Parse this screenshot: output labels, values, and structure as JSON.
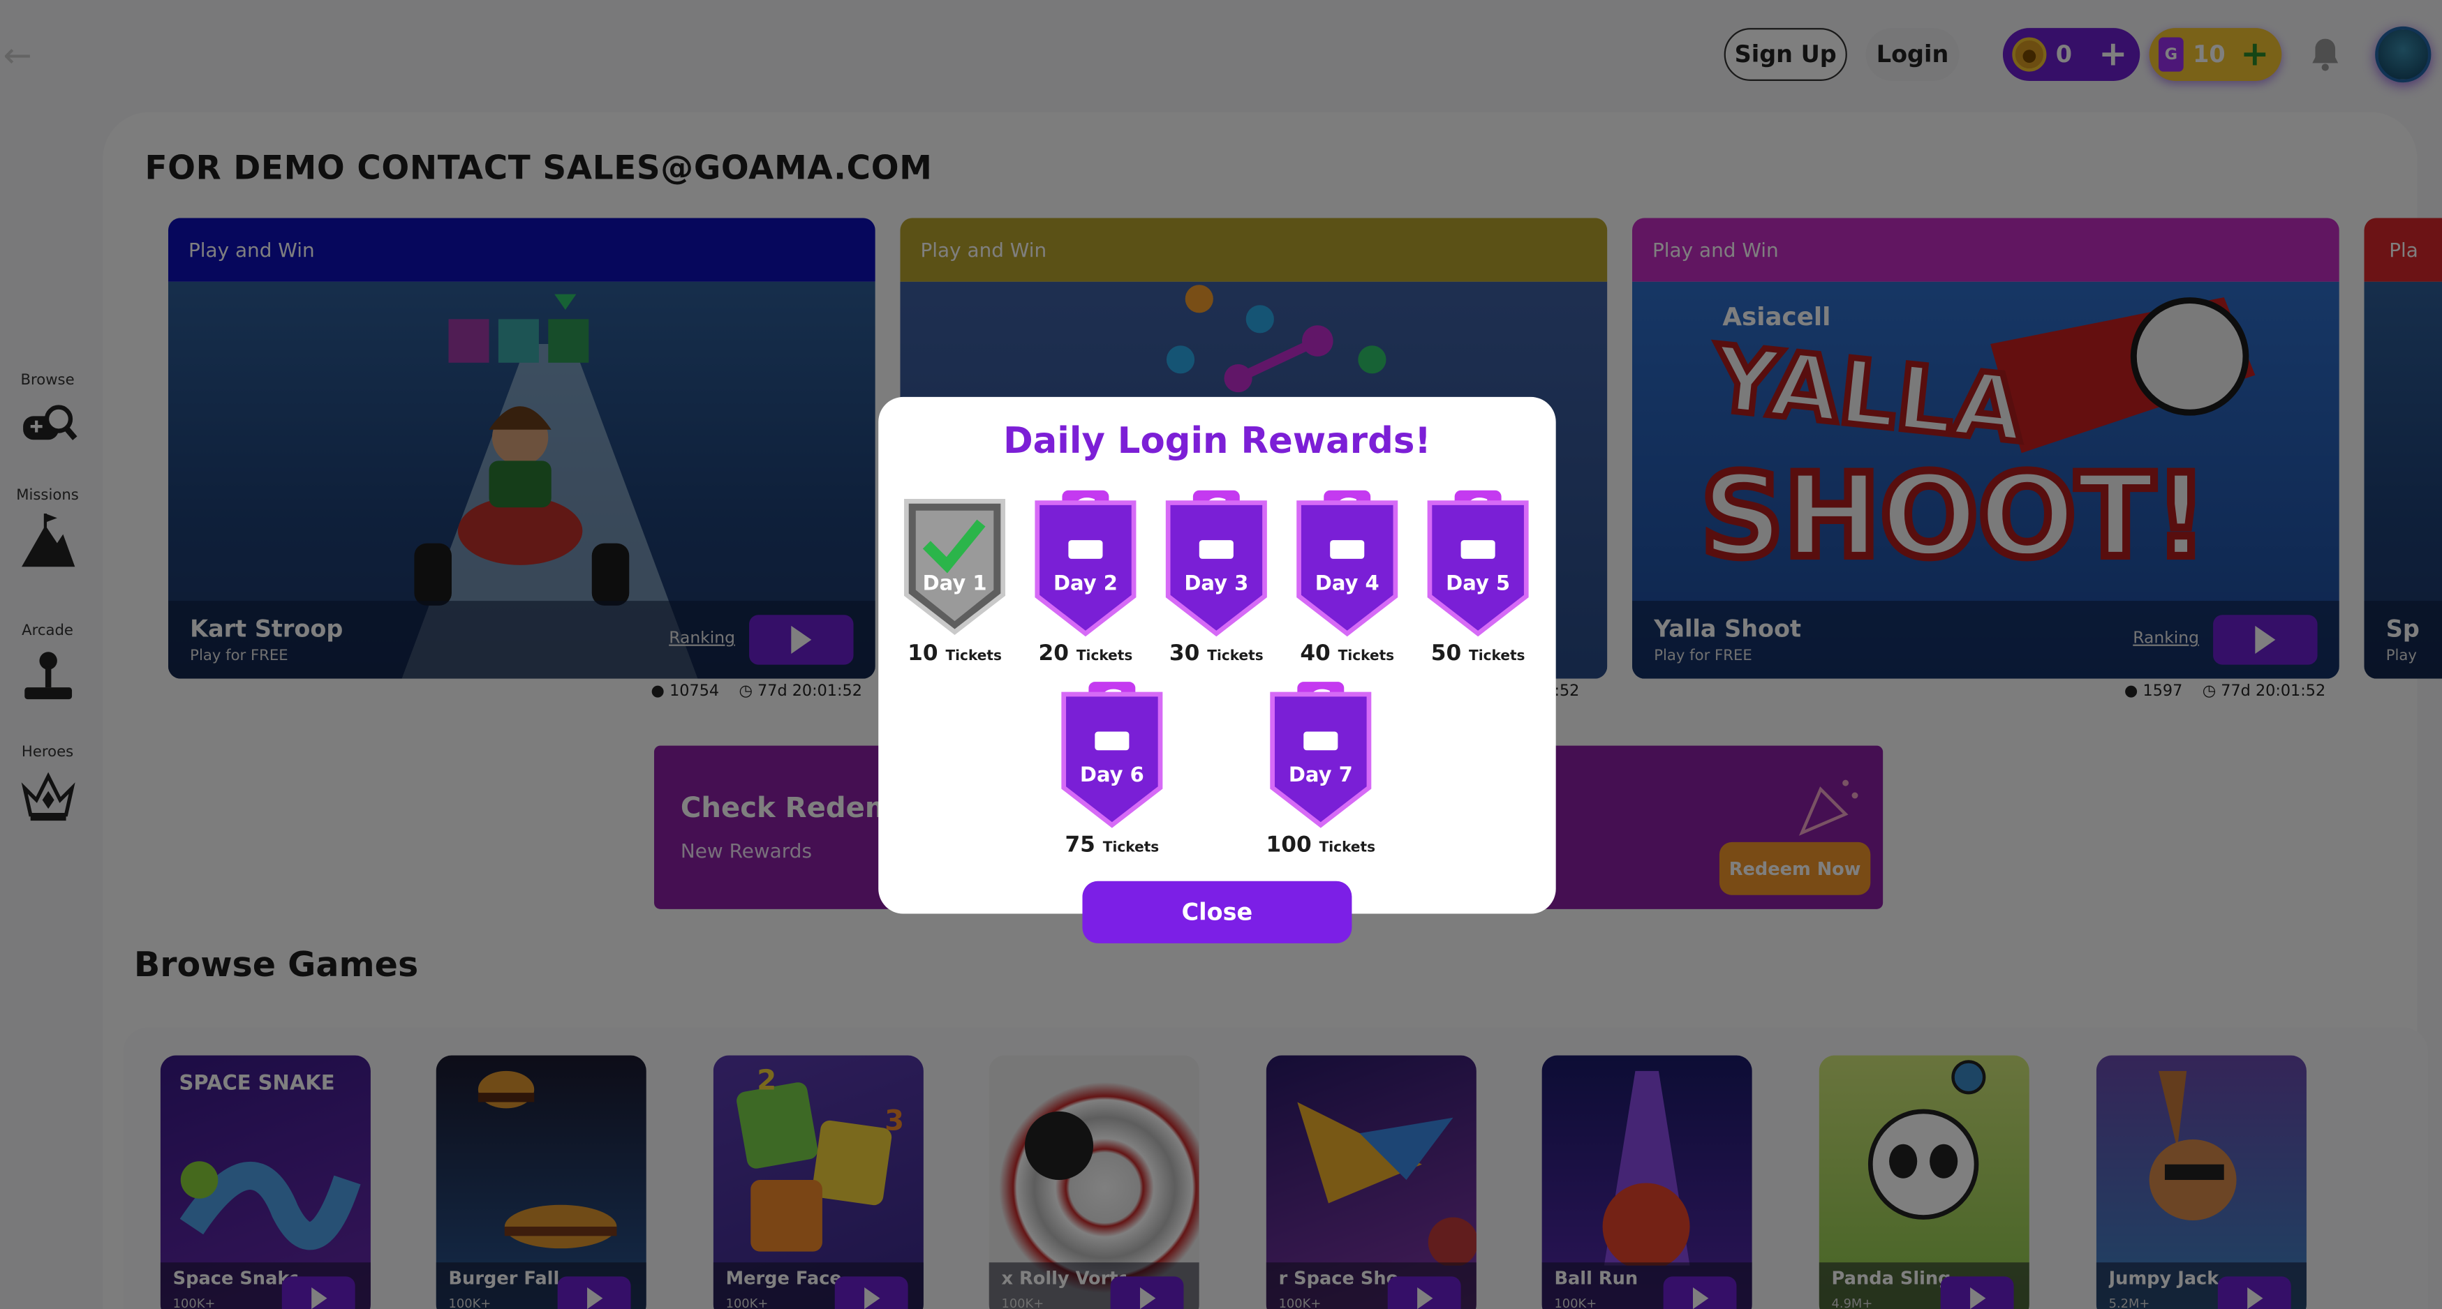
{
  "topbar": {
    "back_icon": "arrow-left-icon",
    "signup_label": "Sign Up",
    "login_label": "Login",
    "coins_value": "0",
    "tickets_value": "10",
    "coin_icon": "coin-icon",
    "ticket_icon": "ticket-icon",
    "bell_icon": "bell-icon",
    "add_glyph": "+"
  },
  "sidebar": {
    "items": [
      {
        "label": "Browse",
        "icon": "gamepad-search-icon"
      },
      {
        "label": "Missions",
        "icon": "mountain-flag-icon"
      },
      {
        "label": "Arcade",
        "icon": "joystick-icon"
      },
      {
        "label": "Heroes",
        "icon": "crown-icon"
      }
    ]
  },
  "banner": {
    "text": "FOR DEMO CONTACT SALES@GOAMA.COM"
  },
  "featured": [
    {
      "tag": "Play and Win",
      "title": "Kart Stroop",
      "subtitle": "Play for FREE",
      "ranking": "Ranking",
      "players": "10754",
      "timer": "77d 20:01:52",
      "head_color": "#0d0fb8"
    },
    {
      "tag": "Play and Win",
      "title": "",
      "subtitle": "",
      "ranking": "",
      "players": "",
      "timer": ":52",
      "head_color": "#b7a22c"
    },
    {
      "tag": "Play and Win",
      "title": "Yalla Shoot",
      "subtitle": "Play for FREE",
      "ranking": "Ranking",
      "players": "1597",
      "timer": "77d 20:01:52",
      "head_color": "#c32dc3",
      "art_text_1": "Asiacell",
      "art_text_2": "YALLA",
      "art_text_3": "SHOOT!"
    },
    {
      "tag": "Pla",
      "title": "Sp",
      "subtitle": "Play",
      "head_color": "#d9262b"
    }
  ],
  "promo": {
    "title": "Check Redem",
    "subtitle": "New Rewards",
    "button": "Redeem Now"
  },
  "browse": {
    "title": "Browse Games",
    "games": [
      {
        "name": "Space Snake",
        "count": "100K+",
        "art_text": "SPACE SNAKE"
      },
      {
        "name": "Burger Fall",
        "count": "100K+"
      },
      {
        "name": "Merge Face",
        "count": "100K+",
        "art_text_1": "2",
        "art_text_2": "3"
      },
      {
        "name": "x Rolly Vorte",
        "count": "100K+"
      },
      {
        "name": "r Space Sho",
        "count": "100K+"
      },
      {
        "name": "Ball Run",
        "count": "100K+"
      },
      {
        "name": "Panda Sling",
        "count": "4.9M+"
      },
      {
        "name": "Jumpy Jack",
        "count": "5.2M+"
      }
    ]
  },
  "modal": {
    "title": "Daily Login Rewards!",
    "brand_glyph": "G",
    "unit": "Tickets",
    "rewards": [
      {
        "day": "Day 1",
        "amount": "10",
        "claimed": true
      },
      {
        "day": "Day 2",
        "amount": "20",
        "claimed": false
      },
      {
        "day": "Day 3",
        "amount": "30",
        "claimed": false
      },
      {
        "day": "Day 4",
        "amount": "40",
        "claimed": false
      },
      {
        "day": "Day 5",
        "amount": "50",
        "claimed": false
      },
      {
        "day": "Day 6",
        "amount": "75",
        "claimed": false
      },
      {
        "day": "Day 7",
        "amount": "100",
        "claimed": false
      }
    ],
    "close_label": "Close"
  },
  "colors": {
    "accent": "#7c1fe6",
    "title": "#7c1fd6",
    "coin_pill": "#6d1fd0",
    "ticket_pill": "#f4c430",
    "redeem": "#f3972a",
    "promo": "#8a1ea4"
  }
}
